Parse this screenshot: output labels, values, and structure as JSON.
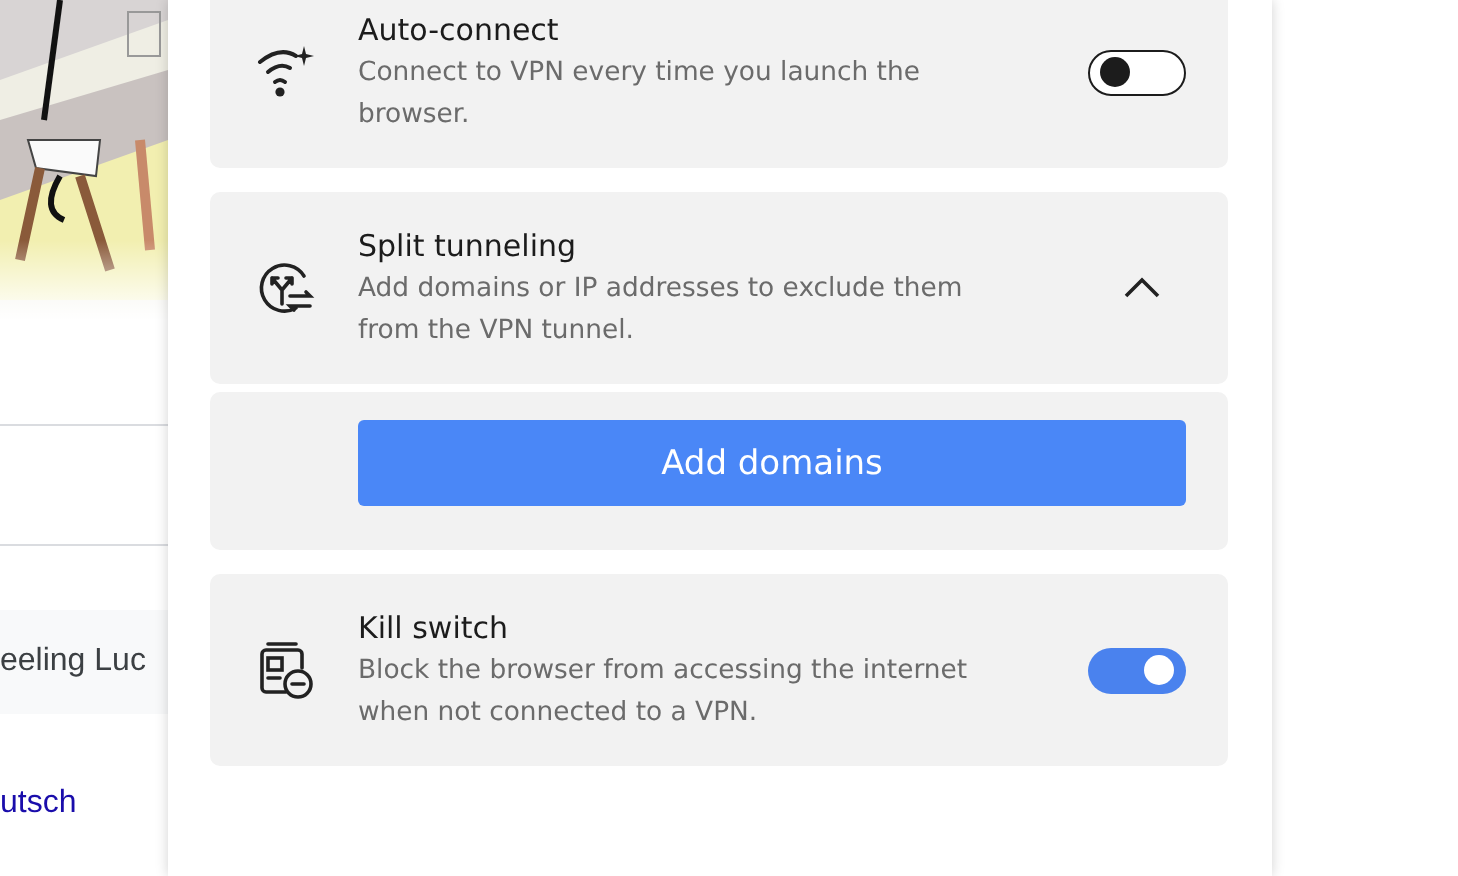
{
  "background_page": {
    "search_button": "eeling Luc",
    "language_link": "utsch"
  },
  "settings": [
    {
      "kind": "toggle",
      "title": "Auto-connect",
      "description": "Connect to VPN every time you launch the browser.",
      "on": false
    },
    {
      "kind": "expandable",
      "title": "Split tunneling",
      "description": "Add domains or IP addresses to exclude them from the VPN tunnel.",
      "expanded": true,
      "action": "Add domains"
    },
    {
      "kind": "toggle",
      "title": "Kill switch",
      "description": "Block the browser from accessing the internet when not connected to a VPN.",
      "on": true
    }
  ]
}
